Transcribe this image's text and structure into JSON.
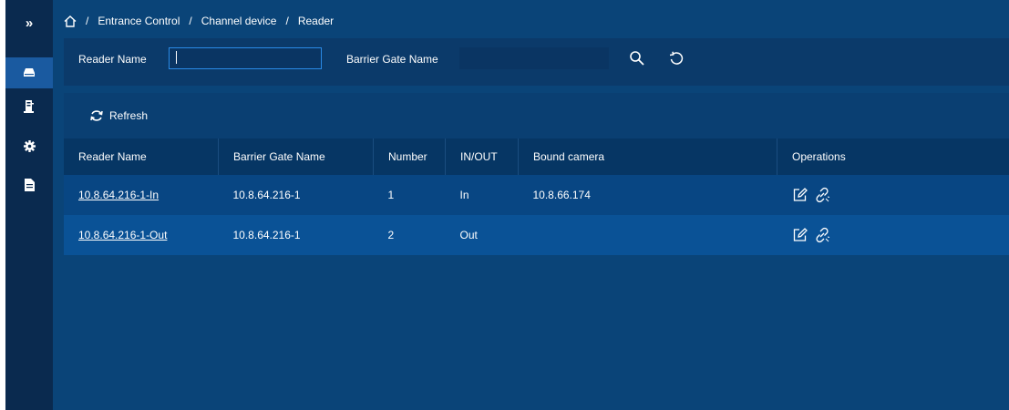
{
  "colors": {
    "sidebar_bg": "#0a2a4f",
    "content_bg": "#0a4478",
    "header_bg": "#063664",
    "row_odd": "#084683",
    "row_even": "#0a5296",
    "accent": "#2a8ae6"
  },
  "sidebar": {
    "toggle_label": "»",
    "items": [
      {
        "icon": "vehicle-icon",
        "active": true
      },
      {
        "icon": "gate-icon",
        "active": false
      },
      {
        "icon": "gear-icon",
        "active": false
      },
      {
        "icon": "document-icon",
        "active": false
      }
    ]
  },
  "breadcrumb": {
    "home_icon": "home-icon",
    "separator": "/",
    "items": [
      "Entrance Control",
      "Channel device",
      "Reader"
    ]
  },
  "filters": {
    "reader_name_label": "Reader Name",
    "reader_name_value": "",
    "barrier_gate_label": "Barrier Gate Name",
    "barrier_gate_value": ""
  },
  "toolbar": {
    "refresh_label": "Refresh"
  },
  "table": {
    "columns": [
      "Reader Name",
      "Barrier Gate Name",
      "Number",
      "IN/OUT",
      "Bound camera",
      "Operations"
    ],
    "rows": [
      {
        "reader_name": "10.8.64.216-1-In",
        "barrier_gate_name": "10.8.64.216-1",
        "number": "1",
        "in_out": "In",
        "bound_camera": "10.8.66.174"
      },
      {
        "reader_name": "10.8.64.216-1-Out",
        "barrier_gate_name": "10.8.64.216-1",
        "number": "2",
        "in_out": "Out",
        "bound_camera": ""
      }
    ]
  }
}
